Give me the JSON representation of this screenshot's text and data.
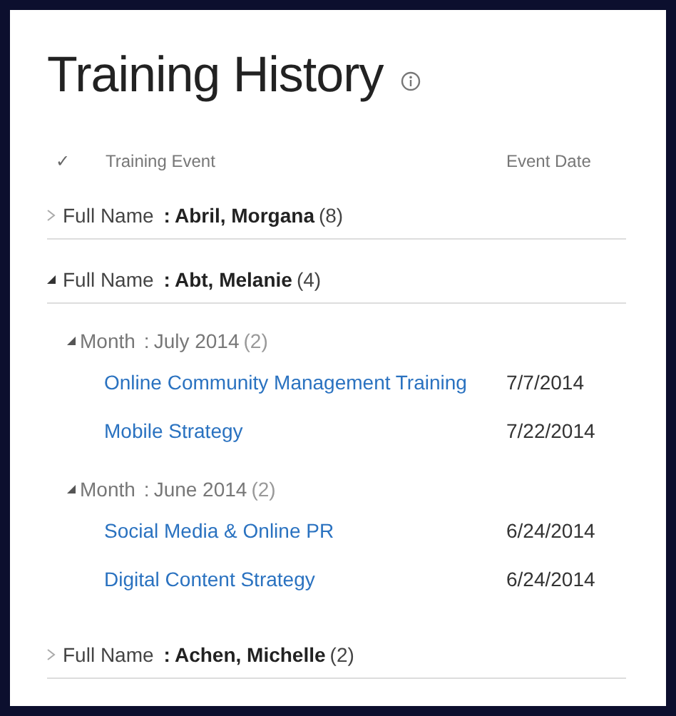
{
  "title": "Training History",
  "columns": {
    "check": "✓",
    "event": "Training Event",
    "date": "Event Date"
  },
  "groups": [
    {
      "field": "Full Name",
      "separator": ":",
      "value": "Abril, Morgana",
      "count": "(8)",
      "expanded": false
    },
    {
      "field": "Full Name",
      "separator": ":",
      "value": "Abt, Melanie",
      "count": "(4)",
      "expanded": true,
      "children": [
        {
          "field": "Month",
          "separator": ":",
          "value": "July 2014",
          "count": "(2)",
          "expanded": true,
          "items": [
            {
              "event": "Online Community Management Training",
              "date": "7/7/2014"
            },
            {
              "event": "Mobile Strategy",
              "date": "7/22/2014"
            }
          ]
        },
        {
          "field": "Month",
          "separator": ":",
          "value": "June 2014",
          "count": "(2)",
          "expanded": true,
          "items": [
            {
              "event": "Social Media & Online PR",
              "date": "6/24/2014"
            },
            {
              "event": "Digital Content Strategy",
              "date": "6/24/2014"
            }
          ]
        }
      ]
    },
    {
      "field": "Full Name",
      "separator": ":",
      "value": "Achen, Michelle",
      "count": "(2)",
      "expanded": false
    }
  ]
}
